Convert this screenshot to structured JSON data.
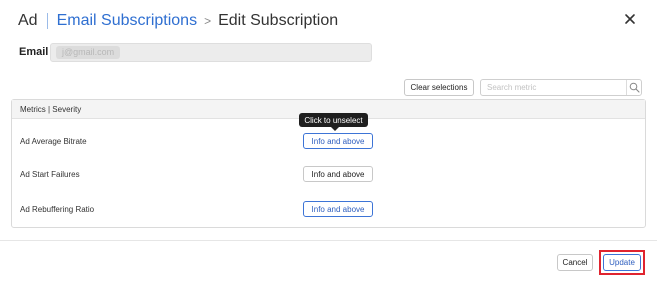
{
  "header": {
    "prefix": "Ad",
    "link": "Email Subscriptions",
    "separator": ">",
    "current": "Edit Subscription",
    "close_icon": "close-icon"
  },
  "email": {
    "label": "Email",
    "value": "j@gmail.com"
  },
  "toolbar": {
    "clear_label": "Clear selections",
    "search_placeholder": "Search metric",
    "search_icon": "search-icon"
  },
  "table": {
    "header": "Metrics | Severity",
    "rows": [
      {
        "metric": "Ad Average Bitrate",
        "severity": "Info and above",
        "selected": true
      },
      {
        "metric": "Ad Start Failures",
        "severity": "Info and above",
        "selected": false
      },
      {
        "metric": "Ad Rebuffering Ratio",
        "severity": "Info and above",
        "selected": true
      }
    ]
  },
  "tooltip": "Click to unselect",
  "footer": {
    "cancel_label": "Cancel",
    "update_label": "Update"
  },
  "colors": {
    "link": "#2f6fd1",
    "selected_border": "#3d74d6",
    "highlight": "#e0242f"
  }
}
